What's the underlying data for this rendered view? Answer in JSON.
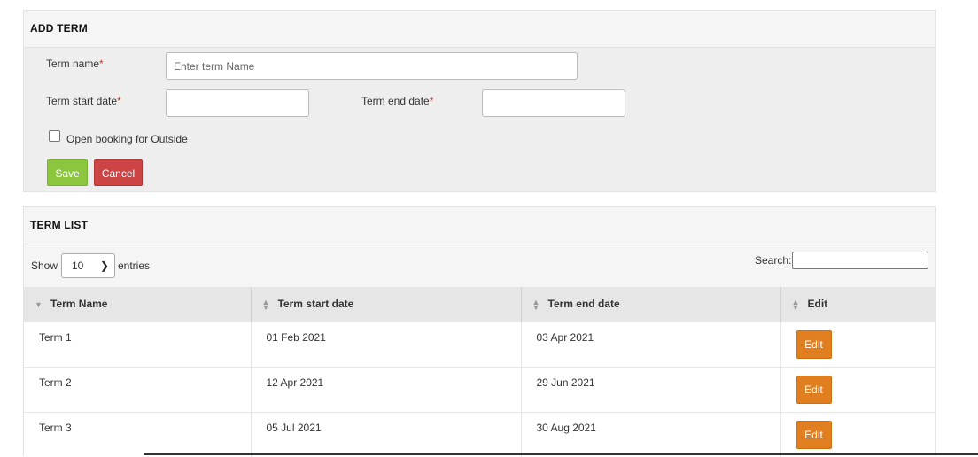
{
  "add_term": {
    "title": "ADD TERM",
    "term_name_label": "Term name",
    "term_name_placeholder": "Enter term Name",
    "start_label": "Term start date",
    "end_label": "Term end date",
    "required_mark": "*",
    "open_booking_label": "Open booking for Outside",
    "open_booking_checked": false,
    "save_label": "Save",
    "cancel_label": "Cancel"
  },
  "term_list": {
    "title": "TERM LIST",
    "show_label": "Show",
    "entries_value": "10",
    "entries_label": "entries",
    "search_label": "Search:",
    "columns": [
      "Term Name",
      "Term start date",
      "Term end date",
      "Edit"
    ],
    "rows": [
      {
        "name": "Term 1",
        "start": "01 Feb 2021",
        "end": "03 Apr 2021",
        "edit": "Edit"
      },
      {
        "name": "Term 2",
        "start": "12 Apr 2021",
        "end": "29 Jun 2021",
        "edit": "Edit"
      },
      {
        "name": "Term 3",
        "start": "05 Jul 2021",
        "end": "30 Aug 2021",
        "edit": "Edit"
      }
    ]
  },
  "colors": {
    "save": "#8cc63f",
    "cancel": "#cc4444",
    "edit": "#e07e20",
    "required": "#c0392b"
  }
}
